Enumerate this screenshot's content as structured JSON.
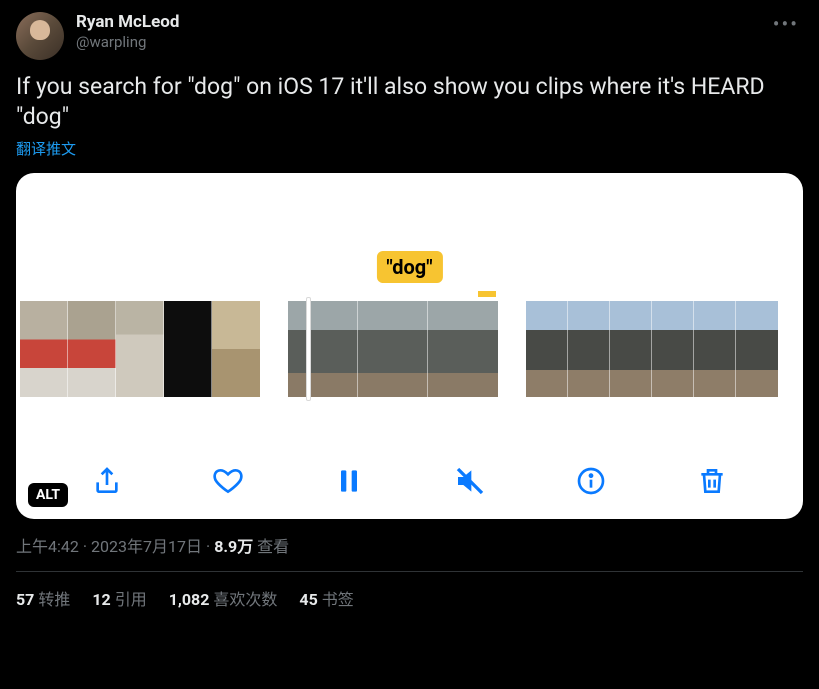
{
  "author": {
    "name": "Ryan McLeod",
    "handle": "@warpling"
  },
  "tweet_text": "If you search for \"dog\" on iOS 17 it'll also show you clips where it's HEARD \"dog\"",
  "translate_label": "翻译推文",
  "media": {
    "badge_text": "\"dog\"",
    "alt_label": "ALT",
    "toolbar": {
      "share": "share",
      "like": "like",
      "pause": "pause",
      "mute": "mute",
      "info": "info",
      "delete": "delete"
    }
  },
  "meta": {
    "time": "上午4:42",
    "date": "2023年7月17日",
    "views_count": "8.9万",
    "views_label": "查看"
  },
  "stats": {
    "retweets": {
      "count": "57",
      "label": "转推"
    },
    "quotes": {
      "count": "12",
      "label": "引用"
    },
    "likes": {
      "count": "1,082",
      "label": "喜欢次数"
    },
    "bookmarks": {
      "count": "45",
      "label": "书签"
    }
  }
}
